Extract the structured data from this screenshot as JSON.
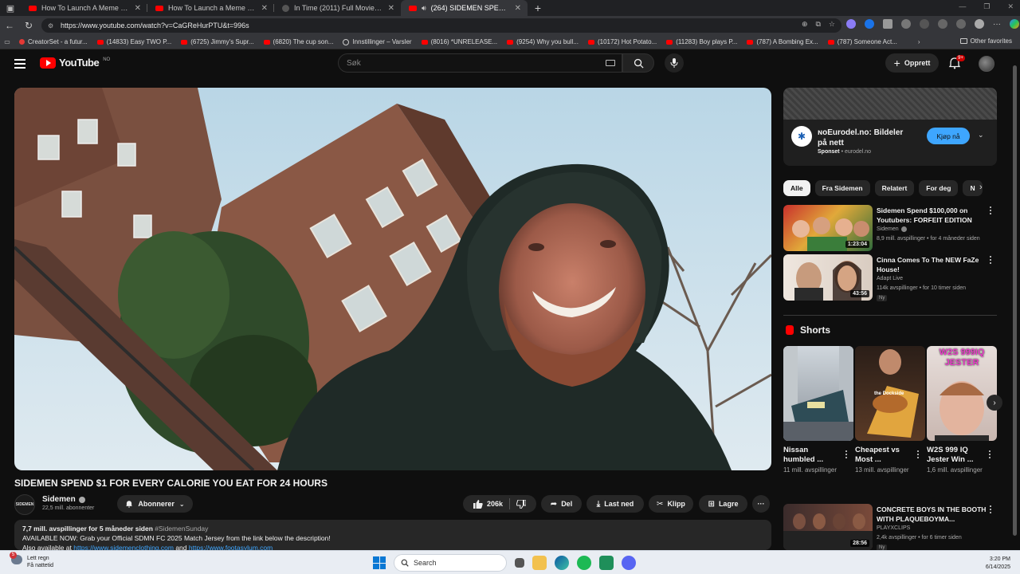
{
  "browser": {
    "tabs": [
      {
        "title": "How To Launch A Meme Coin And",
        "active": false
      },
      {
        "title": "How To Launch a Meme Coin And",
        "active": false
      },
      {
        "title": "In Time (2011) Full Movie HD - w",
        "active": false
      },
      {
        "title": "(264) SIDEMEN SPEND $1 F",
        "active": true
      }
    ],
    "url": "https://www.youtube.com/watch?v=CaGReHurPTU&t=996s",
    "bookmarks": [
      "CreatorSet - a futur...",
      "(14833) Easy TWO P...",
      "(6725) Jimmy's Supr...",
      "(6820) The cup son...",
      "Innstillinger – Varsler",
      "(8016) *UNRELEASE...",
      "(9254) Why you bull...",
      "(10172) Hot Potato...",
      "(11283) Boy plays P...",
      "(787) A Bombing Ex...",
      "(787) Someone Act..."
    ],
    "other_favorites": "Other favorites"
  },
  "header": {
    "logo_text": "YouTube",
    "country": "NO",
    "search_placeholder": "Søk",
    "create_label": "Opprett",
    "notifications": "9+"
  },
  "video": {
    "title": "SIDEMEN SPEND $1 FOR EVERY CALORIE YOU EAT FOR 24 HOURS",
    "channel": "Sidemen",
    "channel_avatar_text": "SIDEMEN",
    "subscribers": "22,5 mill. abonnenter",
    "subscribe_label": "Abonnerer",
    "likes": "206k",
    "share_label": "Del",
    "download_label": "Last ned",
    "clip_label": "Klipp",
    "save_label": "Lagre",
    "desc_meta": "7,7 mill. avspillinger  for 5 måneder siden",
    "desc_tag": "#SidemenSunday",
    "desc_line1": "AVAILABLE NOW: Grab your Official SDMN FC 2025 Match Jersey from the link below the description!",
    "desc_line2_prefix": "Also available at",
    "desc_link1": "https://www.sidemenclothing.com",
    "desc_and": "and",
    "desc_link2": "https://www.footasylum.com"
  },
  "ad": {
    "title": "ɴoEurodel.no: Bildeler på nett",
    "sponsored": "Sponset",
    "domain": "eurodel.no",
    "cta": "Kjøp nå"
  },
  "chips": [
    "Alle",
    "Fra Sidemen",
    "Relatert",
    "For deg",
    "N"
  ],
  "recommendations": [
    {
      "title": "Sidemen Spend $100,000 on Youtubers: FORFEIT EDITION",
      "channel": "Sidemen",
      "stats": "8,9 mill. avspillinger • for 4 måneder siden",
      "duration": "1:23:04",
      "new": ""
    },
    {
      "title": "Cinna Comes To The NEW FaZe House!",
      "channel": "Adapt Live",
      "stats": "114k avspillinger • for 10 timer siden",
      "duration": "43:56",
      "new": "Ny"
    },
    {
      "title": "CONCRETE BOYS IN THE BOOTH WITH PLAQUEBOYMA...",
      "channel": "PLAYXCLIPS",
      "stats": "2,4k avspillinger • for 6 timer siden",
      "duration": "28:56",
      "new": "Ny"
    }
  ],
  "shorts": {
    "heading": "Shorts",
    "items": [
      {
        "title": "Nissan humbled ...",
        "views": "11 mill. avspillinger"
      },
      {
        "title": "Cheapest vs Most ...",
        "views": "13 mill. avspillinger"
      },
      {
        "title": "W2S 999 IQ Jester Win ...",
        "views": "1,6 mill. avspillinger",
        "overlay": "W2S 999IQ JESTER"
      }
    ],
    "dockside": "the Dockside"
  },
  "taskbar": {
    "weather_line1": "Lett regn",
    "weather_line2": "Få nattetid",
    "weather_badge": "5",
    "search_label": "Search",
    "time": "3:20 PM",
    "date": "6/14/2025"
  }
}
